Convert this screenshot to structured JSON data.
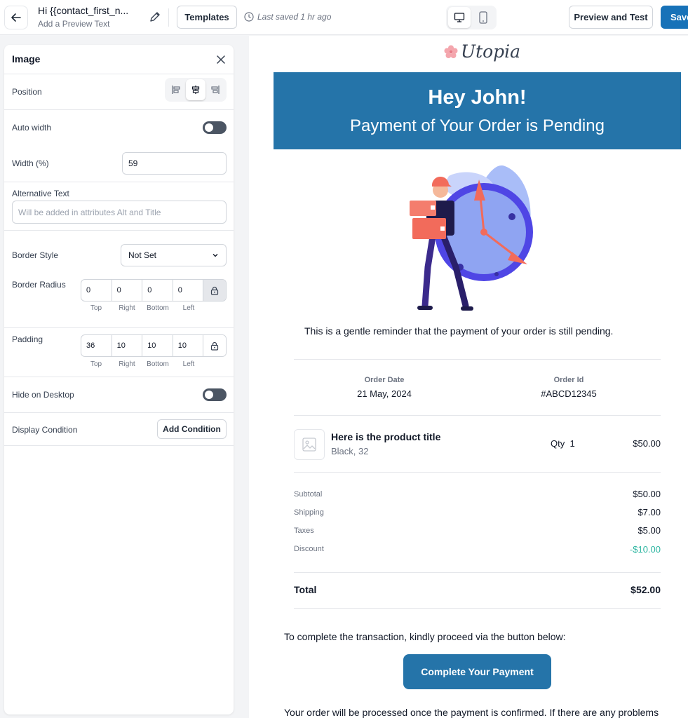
{
  "topbar": {
    "subject": "Hi {{contact_first_n...",
    "preview_text": "Add a Preview Text",
    "templates_label": "Templates",
    "last_saved": "Last saved 1 hr ago",
    "preview_test_label": "Preview and Test",
    "save_label": "Save"
  },
  "panel": {
    "title": "Image",
    "position_label": "Position",
    "position_options": [
      "align-left-icon",
      "align-center-icon",
      "align-right-icon"
    ],
    "position_selected": "align-center-icon",
    "auto_width_label": "Auto width",
    "auto_width_on": false,
    "width_label": "Width (%)",
    "width_value": "59",
    "alt_text_label": "Alternative Text",
    "alt_text_placeholder": "Will be added in attributes Alt and Title",
    "border_style_label": "Border Style",
    "border_style_value": "Not Set",
    "border_radius_label": "Border Radius",
    "border_radius": {
      "top": "0",
      "right": "0",
      "bottom": "0",
      "left": "0"
    },
    "padding_label": "Padding",
    "padding": {
      "top": "36",
      "right": "10",
      "bottom": "10",
      "left": "10"
    },
    "side_labels": {
      "top": "Top",
      "right": "Right",
      "bottom": "Bottom",
      "left": "Left"
    },
    "hide_desktop_label": "Hide on Desktop",
    "hide_desktop_on": false,
    "display_condition_label": "Display Condition",
    "add_condition_label": "Add Condition"
  },
  "email": {
    "logo_text": "Utopia",
    "hero_title": "Hey John!",
    "hero_subtitle": "Payment of Your Order is Pending",
    "reminder": "This is a gentle reminder that the payment of your order is still pending.",
    "order_date_label": "Order Date",
    "order_date_value": "21 May, 2024",
    "order_id_label": "Order Id",
    "order_id_value": "#ABCD12345",
    "product_title": "Here is the product title",
    "product_variant": "Black, 32",
    "qty_label": "Qty",
    "qty_value": "1",
    "product_price": "$50.00",
    "summary": [
      {
        "label": "Subtotal",
        "value": "$50.00"
      },
      {
        "label": "Shipping",
        "value": "$7.00"
      },
      {
        "label": "Taxes",
        "value": "$5.00"
      },
      {
        "label": "Discount",
        "value": "-$10.00"
      }
    ],
    "total_label": "Total",
    "total_value": "$52.00",
    "cta_text": "To complete the transaction, kindly proceed via the button below:",
    "cta_button": "Complete Your Payment",
    "footer_text": "Your order will be processed once the payment is confirmed. If there are any problems"
  },
  "colors": {
    "brand_blue": "#2574a9",
    "save_blue": "#1772b8",
    "discount_green": "#2bb5a0",
    "illustration_accent": "#f26b5b",
    "illustration_purple": "#4f46e5"
  }
}
